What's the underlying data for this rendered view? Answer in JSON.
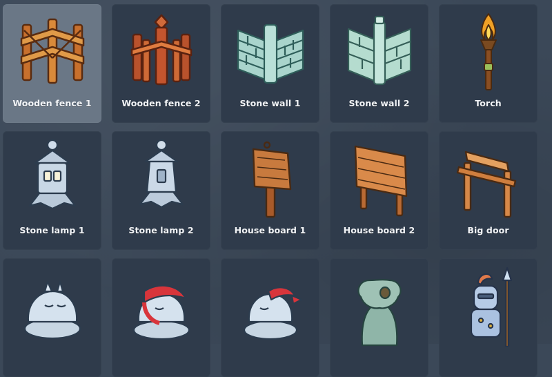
{
  "items": [
    {
      "label": "Wooden fence 1",
      "icon": "wooden-fence-icon",
      "selected": true
    },
    {
      "label": "Wooden fence 2",
      "icon": "wooden-fence-2-icon",
      "selected": false
    },
    {
      "label": "Stone wall 1",
      "icon": "stone-wall-icon",
      "selected": false
    },
    {
      "label": "Stone wall 2",
      "icon": "stone-wall-2-icon",
      "selected": false
    },
    {
      "label": "Torch",
      "icon": "torch-icon",
      "selected": false
    },
    {
      "label": "Stone lamp 1",
      "icon": "stone-lamp-icon",
      "selected": false
    },
    {
      "label": "Stone lamp 2",
      "icon": "stone-lamp-2-icon",
      "selected": false
    },
    {
      "label": "House board 1",
      "icon": "house-board-icon",
      "selected": false
    },
    {
      "label": "House board 2",
      "icon": "house-board-2-icon",
      "selected": false
    },
    {
      "label": "Big door",
      "icon": "big-door-icon",
      "selected": false
    },
    {
      "label": "",
      "icon": "sleeping-creature-statue-icon",
      "selected": false
    },
    {
      "label": "",
      "icon": "sleeping-creature-red-cape-icon",
      "selected": false
    },
    {
      "label": "",
      "icon": "sleeping-creature-red-bandana-icon",
      "selected": false
    },
    {
      "label": "",
      "icon": "rabbit-statue-icon",
      "selected": false
    },
    {
      "label": "",
      "icon": "knight-with-spear-icon",
      "selected": false
    }
  ],
  "colors": {
    "background": "#3b4858",
    "tile": "#2f3b4b",
    "tile_selected": "#6a7786",
    "label": "#f2f4f7",
    "wood": "#c8702d",
    "stone": "#a9d4cc",
    "stone_lamp": "#c9d8e6",
    "red": "#d8353b"
  }
}
